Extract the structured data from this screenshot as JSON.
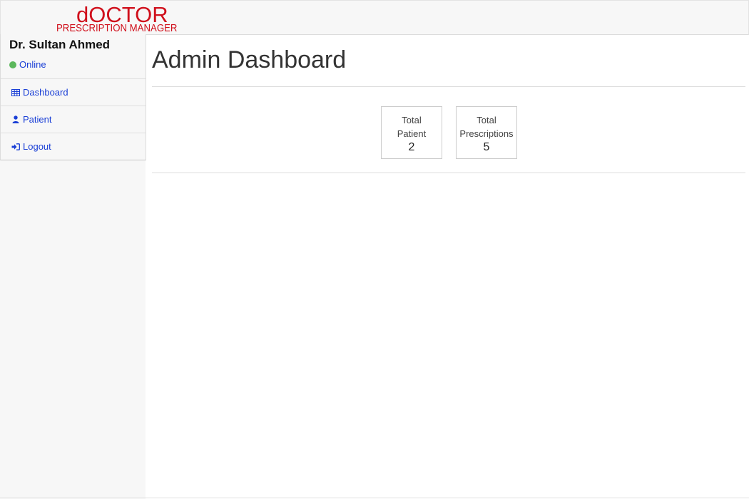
{
  "logo": {
    "main": "dOCTOR",
    "sub": "PRESCRIPTION MANAGER"
  },
  "sidebar": {
    "doctor_name": "Dr. Sultan Ahmed",
    "status": "Online",
    "status_color": "#5cb85c",
    "items": [
      {
        "label": "Dashboard",
        "icon": "table-icon"
      },
      {
        "label": "Patient",
        "icon": "user-icon"
      },
      {
        "label": "Logout",
        "icon": "sign-in-icon"
      }
    ]
  },
  "main": {
    "title": "Admin Dashboard",
    "stats": [
      {
        "label_line1": "Total",
        "label_line2": "Patient",
        "value": "2"
      },
      {
        "label_line1": "Total",
        "label_line2": "Prescriptions",
        "value": "5"
      }
    ]
  },
  "colors": {
    "brand": "#d0101c",
    "link": "#1a3fd6"
  }
}
